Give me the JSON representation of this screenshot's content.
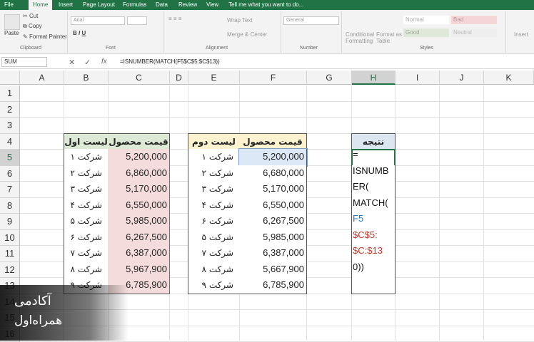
{
  "tabs": [
    "File",
    "Home",
    "Insert",
    "Page Layout",
    "Formulas",
    "Data",
    "Review",
    "View",
    "Tell me what you want to do..."
  ],
  "ribbon": {
    "paste": "Paste",
    "cut": "Cut",
    "copy": "Copy",
    "format_painter": "Format Painter",
    "clipboard": "Clipboard",
    "font_name": "Arial",
    "font": "Font",
    "wrap": "Wrap Text",
    "merge": "Merge & Center",
    "alignment": "Alignment",
    "number_format": "General",
    "number": "Number",
    "cond1": "Conditional",
    "cond2": "Formatting",
    "fmt1": "Format as",
    "fmt2": "Table",
    "styles": "Styles",
    "s_normal": "Normal",
    "s_bad": "Bad",
    "s_good": "Good",
    "s_neutral": "Neutral",
    "insert": "Insert"
  },
  "name_box": "SUM",
  "formula": "=ISNUMBER(MATCH(F5$C$5:$C$13))",
  "columns": [
    "A",
    "B",
    "C",
    "D",
    "E",
    "F",
    "G",
    "H",
    "I",
    "J",
    "K"
  ],
  "rows": [
    "1",
    "2",
    "3",
    "4",
    "5",
    "6",
    "7",
    "8",
    "9",
    "10",
    "11",
    "12",
    "13",
    "14",
    "15",
    "16"
  ],
  "list1": {
    "col_b": "لیست اول",
    "col_c": "قیمت محصول",
    "rows": [
      [
        "شرکت ۱",
        "5,200,000"
      ],
      [
        "شرکت ۲",
        "6,860,000"
      ],
      [
        "شرکت ۳",
        "5,170,000"
      ],
      [
        "شرکت ۴",
        "6,550,000"
      ],
      [
        "شرکت ۵",
        "5,985,000"
      ],
      [
        "شرکت ۶",
        "6,267,500"
      ],
      [
        "شرکت ۷",
        "6,387,000"
      ],
      [
        "شرکت ۸",
        "5,967,900"
      ],
      [
        "شرکت ۹",
        "6,785,900"
      ]
    ]
  },
  "list2": {
    "col_e": "لیست دوم",
    "col_f": "قیمت محصول",
    "rows": [
      [
        "شرکت ۱",
        "5,200,000"
      ],
      [
        "شرکت ۲",
        "6,680,000"
      ],
      [
        "شرکت ۳",
        "5,170,000"
      ],
      [
        "شرکت ۴",
        "6,550,000"
      ],
      [
        "شرکت ۶",
        "6,267,500"
      ],
      [
        "شرکت ۵",
        "5,985,000"
      ],
      [
        "شرکت ۷",
        "6,387,000"
      ],
      [
        "شرکت ۸",
        "5,667,900"
      ],
      [
        "شرکت ۹",
        "6,785,900"
      ]
    ]
  },
  "result": {
    "header": "نتیجه",
    "lines": [
      "=",
      "ISNUMB",
      "ER(",
      "MATCH(",
      "F5",
      "$C$5:",
      "$C:$13",
      "0))"
    ]
  },
  "watermark": {
    "line1": "آکادمی",
    "line2": "همراه‌اول"
  },
  "colors": {
    "excel_green": "#217346",
    "list1_header": "#dce9d5",
    "list1_values": "#f4dcdc",
    "list2_header": "#fdf2d0",
    "result_header": "#dce6f0",
    "selected_cell": "#dde8f6"
  }
}
